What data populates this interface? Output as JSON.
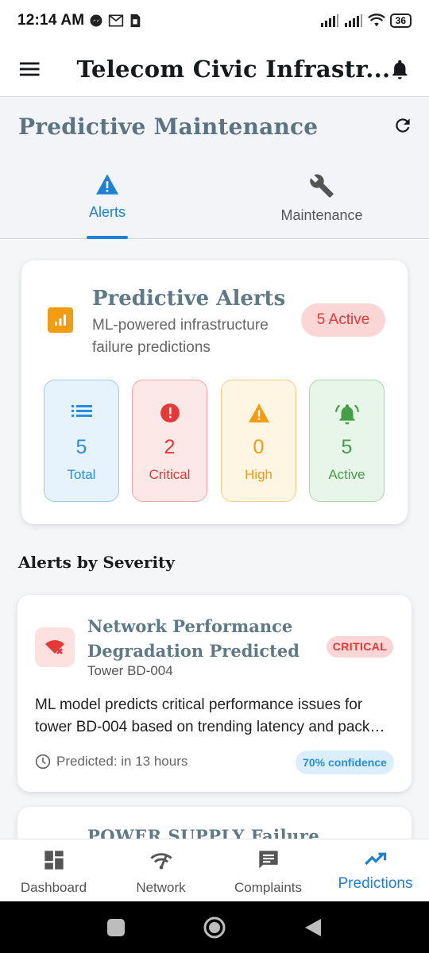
{
  "status_bar": {
    "time": "12:14 AM",
    "battery": "36",
    "icons": [
      "messenger-icon",
      "gmail-icon",
      "sim-icon",
      "signal-icon",
      "signal-icon",
      "wifi-icon",
      "battery-icon"
    ]
  },
  "app_bar": {
    "title": "Telecom Civic Infrastr...",
    "menu_icon": "menu-icon",
    "notification_icon": "bell-icon"
  },
  "page": {
    "title": "Predictive Maintenance",
    "refresh_icon": "refresh-icon",
    "tabs": [
      {
        "label": "Alerts",
        "icon": "warning-icon",
        "active": true
      },
      {
        "label": "Maintenance",
        "icon": "wrench-icon",
        "active": false
      }
    ]
  },
  "summary": {
    "title": "Predictive Alerts",
    "subtitle": "ML-powered infrastructure failure predictions",
    "active_badge": "5 Active",
    "stats": [
      {
        "value": "5",
        "label": "Total",
        "icon": "list-icon",
        "color": "#2a8ee0"
      },
      {
        "value": "2",
        "label": "Critical",
        "icon": "error-icon",
        "color": "#e53935"
      },
      {
        "value": "0",
        "label": "High",
        "icon": "warning-icon",
        "color": "#f39c12"
      },
      {
        "value": "5",
        "label": "Active",
        "icon": "alarm-bell-icon",
        "color": "#43a047"
      }
    ]
  },
  "section_title": "Alerts by Severity",
  "alerts": [
    {
      "title": "Network Performance Degradation Predicted",
      "tower": "Tower BD-004",
      "severity": "CRITICAL",
      "description_line1": "ML model predicts critical performance issues for",
      "description_line2": "tower BD-004 based on trending latency and pack…",
      "predicted": "Predicted: in 13 hours",
      "confidence": "70% confidence",
      "icon": "signal-off-icon"
    },
    {
      "title": "POWER SUPPLY Failure"
    }
  ],
  "bottom_nav": [
    {
      "label": "Dashboard",
      "icon": "dashboard-icon",
      "active": false
    },
    {
      "label": "Network",
      "icon": "network-gauge-icon",
      "active": false
    },
    {
      "label": "Complaints",
      "icon": "chat-icon",
      "active": false
    },
    {
      "label": "Predictions",
      "icon": "trending-up-icon",
      "active": true
    }
  ],
  "colors": {
    "primary": "#1e80d6",
    "title_slate": "#5e7a86",
    "critical": "#e53935",
    "high": "#f39c12",
    "active": "#43a047"
  }
}
